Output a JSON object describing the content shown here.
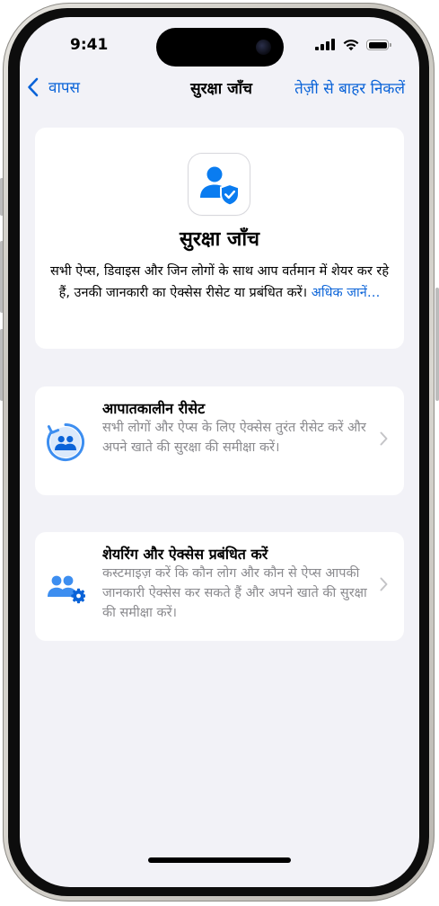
{
  "status": {
    "time": "9:41",
    "icons": [
      "cellular-signal-icon",
      "wifi-icon",
      "battery-icon"
    ]
  },
  "nav": {
    "back_label": "वापस",
    "title": "सुरक्षा जाँच",
    "exit_label": "तेज़ी से बाहर निकलें"
  },
  "hero": {
    "icon": "person-shield-icon",
    "title": "सुरक्षा जाँच",
    "description": "सभी ऐप्स, डिवाइस और जिन लोगों के साथ आप वर्तमान में शेयर कर रहे हैं, उनकी जानकारी का ऐक्सेस रीसेट या प्रबंधित करें।",
    "link": "अधिक जानें…"
  },
  "rows": [
    {
      "icon": "emergency-reset-icon",
      "title": "आपातकालीन रीसेट",
      "subtitle": "सभी लोगों और ऐप्स के लिए ऐक्सेस तुरंत रीसेट करें और अपने खाते की सुरक्षा की समीक्षा करें।"
    },
    {
      "icon": "manage-sharing-icon",
      "title": "शेयरिंग और ऐक्सेस प्रबंधित करें",
      "subtitle": "कस्टमाइज़ करें कि कौन लोग और कौन से ऐप्स आपकी जानकारी ऐक्सेस कर सकते हैं और अपने खाते की सुरक्षा की समीक्षा करें।"
    }
  ],
  "colors": {
    "accent": "#0a63d8",
    "background": "#f2f2f7",
    "secondary_text": "#8a8a8e"
  }
}
